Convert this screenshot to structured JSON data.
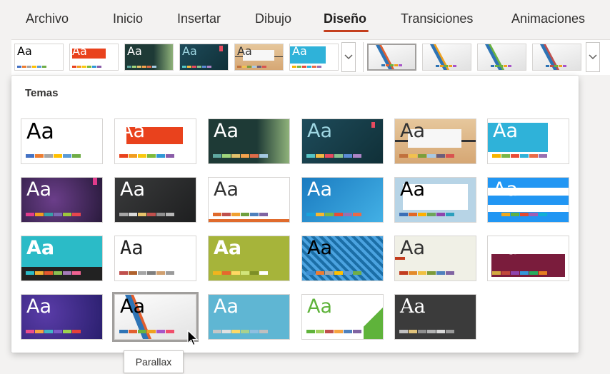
{
  "tabs": [
    {
      "label": "Archivo",
      "active": false
    },
    {
      "label": "Inicio",
      "active": false
    },
    {
      "label": "Insertar",
      "active": false
    },
    {
      "label": "Dibujo",
      "active": false
    },
    {
      "label": "Diseño",
      "active": true
    },
    {
      "label": "Transiciones",
      "active": false
    },
    {
      "label": "Animaciones",
      "active": false
    }
  ],
  "accent_color": "#c43e1c",
  "gallery": {
    "title": "Temas",
    "sample_text": "Aa",
    "tooltip": "Parallax",
    "selected_theme": "Parallax",
    "expand_icon": "chevron-down-icon"
  },
  "strip_variants_count": 4
}
